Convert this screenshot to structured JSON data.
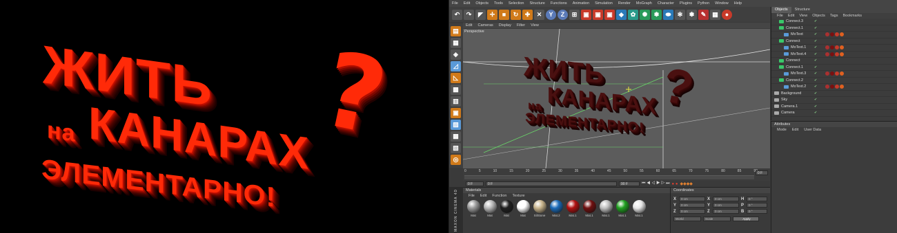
{
  "render": {
    "line1": "ЖИТЬ",
    "line2_small": "на",
    "line2": "КАНАРАХ",
    "line3": "ЭЛЕМЕНТАРНО!",
    "question_mark": "?"
  },
  "menubar": [
    "File",
    "Edit",
    "Objects",
    "Tools",
    "Selection",
    "Structure",
    "Functions",
    "Animation",
    "Simulation",
    "Render",
    "MoGraph",
    "Character",
    "Plugins",
    "Python",
    "Window",
    "Help"
  ],
  "viewport": {
    "menu": [
      "Edit",
      "Cameras",
      "Display",
      "Filter",
      "View"
    ],
    "label": "Perspective"
  },
  "timeline": {
    "ticks": [
      "0",
      "5",
      "10",
      "15",
      "20",
      "25",
      "30",
      "35",
      "40",
      "45",
      "50",
      "55",
      "60",
      "65",
      "70",
      "75",
      "80",
      "85",
      "90"
    ],
    "start_field": "0 F",
    "current_field": "0 F",
    "end_field": "90 F",
    "end_marker": "0 F"
  },
  "materials": {
    "title": "Materials",
    "menu": [
      "File",
      "Edit",
      "Function",
      "Texture"
    ],
    "items": [
      {
        "label": "Mat",
        "color": "#9a9a9a"
      },
      {
        "label": "Mat",
        "color": "#b8b8b8"
      },
      {
        "label": "Mat",
        "color": "#202020"
      },
      {
        "label": "Mat",
        "color": "#ffffff"
      },
      {
        "label": "SilStone",
        "color": "#c8b48c"
      },
      {
        "label": "Mat.2",
        "color": "#1a6ab8"
      },
      {
        "label": "Mat.1",
        "color": "#b01010"
      },
      {
        "label": "Mat.1",
        "color": "#701010"
      },
      {
        "label": "Mat.1",
        "color": "#c0c0c0"
      },
      {
        "label": "Mat.1",
        "color": "#20a020"
      },
      {
        "label": "Mat.1",
        "color": "#e8e8e8"
      }
    ]
  },
  "coordinates": {
    "title": "Coordinates",
    "rows": [
      {
        "a": "X",
        "b": "X",
        "c": "H"
      },
      {
        "a": "Y",
        "b": "Y",
        "c": "P"
      },
      {
        "a": "Z",
        "b": "Z",
        "c": "B"
      }
    ],
    "field_values": [
      "0 cm",
      "0 cm",
      "0 °"
    ],
    "mode_dropdown": "World",
    "scale_dropdown": "Scale",
    "apply_label": "Apply"
  },
  "objects": {
    "tabs": [
      "Objects",
      "Structure"
    ],
    "menu": [
      "File",
      "Edit",
      "View",
      "Objects",
      "Tags",
      "Bookmarks"
    ],
    "items": [
      {
        "name": "Connect.3",
        "indent": 1
      },
      {
        "name": "Connect.1",
        "indent": 1
      },
      {
        "name": "MoText",
        "indent": 2
      },
      {
        "name": "Connect",
        "indent": 1
      },
      {
        "name": "MoText.1",
        "indent": 2
      },
      {
        "name": "MoText.4",
        "indent": 2
      },
      {
        "name": "Connect",
        "indent": 1
      },
      {
        "name": "Connect.1",
        "indent": 1
      },
      {
        "name": "MoText.3",
        "indent": 2
      },
      {
        "name": "Connect.2",
        "indent": 1
      },
      {
        "name": "MoText.2",
        "indent": 2
      },
      {
        "name": "Background",
        "indent": 0
      },
      {
        "name": "Sky",
        "indent": 0
      },
      {
        "name": "Camera.1",
        "indent": 0
      },
      {
        "name": "Camera",
        "indent": 0
      }
    ]
  },
  "attributes": {
    "title": "Attributes",
    "menu": [
      "Mode",
      "Edit",
      "User Data"
    ]
  },
  "brand": "MAXON CINEMA 4D"
}
